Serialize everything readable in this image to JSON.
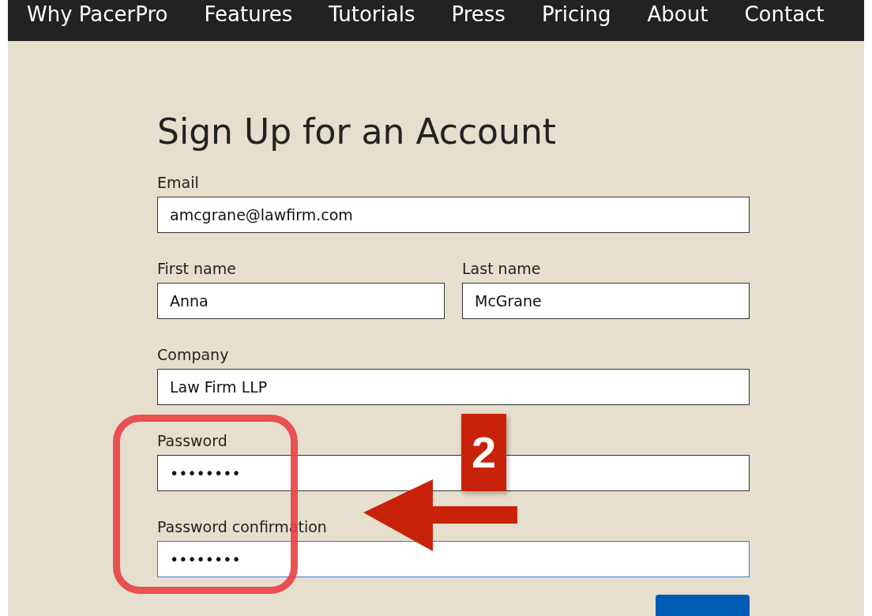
{
  "nav": {
    "items": [
      {
        "label": "Why PacerPro"
      },
      {
        "label": "Features"
      },
      {
        "label": "Tutorials"
      },
      {
        "label": "Press"
      },
      {
        "label": "Pricing"
      },
      {
        "label": "About"
      },
      {
        "label": "Contact"
      }
    ]
  },
  "form": {
    "title": "Sign Up for an Account",
    "rows": [
      [
        {
          "label": "Email",
          "value": "amcgrane@lawfirm.com",
          "focused": false
        }
      ],
      [
        {
          "label": "First name",
          "value": "Anna",
          "focused": false
        },
        {
          "label": "Last name",
          "value": "McGrane",
          "focused": false
        }
      ],
      [
        {
          "label": "Company",
          "value": "Law Firm LLP",
          "focused": false
        }
      ],
      [
        {
          "label": "Password",
          "value": "••••••••",
          "focused": false
        }
      ],
      [
        {
          "label": "Password confirmation",
          "value": "••••••••",
          "focused": true
        }
      ]
    ],
    "submit": {
      "kind": "button"
    }
  },
  "annotation": {
    "number": "2"
  }
}
